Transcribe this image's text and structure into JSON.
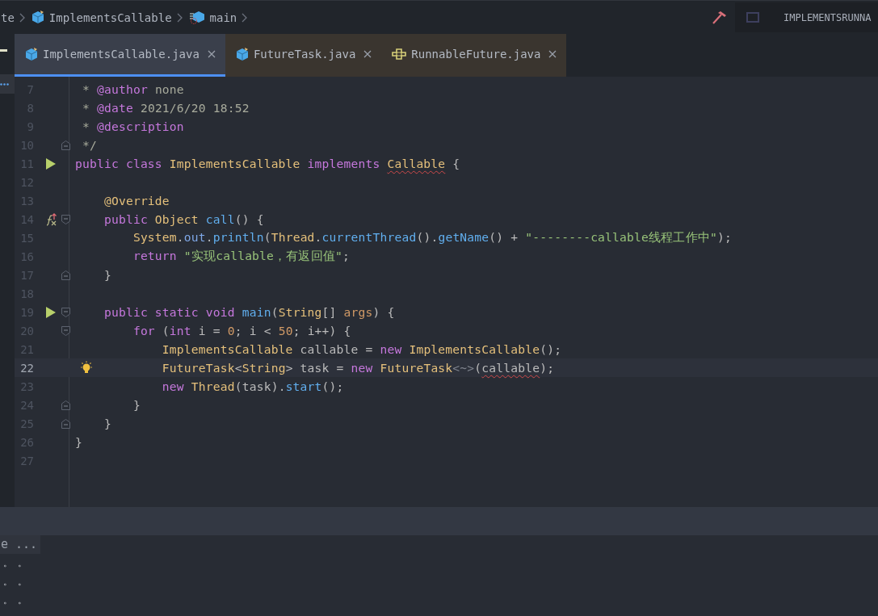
{
  "breadcrumbs": [
    {
      "label": "te",
      "kind": "plain"
    },
    {
      "label": "ImplementsCallable",
      "kind": "class"
    },
    {
      "label": "main",
      "kind": "method"
    }
  ],
  "run_config": {
    "label": "IMPLEMENTSRUNNA"
  },
  "tabs": [
    {
      "label": "ImplementsCallable.java",
      "kind": "class",
      "selected": true
    },
    {
      "label": "FutureTask.java",
      "kind": "class",
      "selected": false
    },
    {
      "label": "RunnableFuture.java",
      "kind": "interface",
      "selected": false
    }
  ],
  "editor": {
    "lines": [
      {
        "number": "7",
        "tokens": [
          {
            "t": " * ",
            "kind": "cmt"
          },
          {
            "t": "@author",
            "kind": "tag"
          },
          {
            "t": " none",
            "kind": "cmt"
          }
        ]
      },
      {
        "number": "8",
        "tokens": [
          {
            "t": " * ",
            "kind": "cmt"
          },
          {
            "t": "@date",
            "kind": "tag"
          },
          {
            "t": " 2021/6/20 18:52",
            "kind": "cmt"
          }
        ]
      },
      {
        "number": "9",
        "tokens": [
          {
            "t": " * ",
            "kind": "cmt"
          },
          {
            "t": "@description",
            "kind": "tag"
          }
        ]
      },
      {
        "number": "10",
        "markers": [
          {
            "kind": "fold_end"
          }
        ],
        "tokens": [
          {
            "t": " */",
            "kind": "cmt"
          }
        ]
      },
      {
        "number": "11",
        "markers": [
          {
            "kind": "run"
          }
        ],
        "tokens": [
          {
            "t": "public class ",
            "kind": "kw"
          },
          {
            "t": "ImplementsCallable ",
            "kind": "cls"
          },
          {
            "t": "implements ",
            "kind": "kw"
          },
          {
            "t": "Callable",
            "kind": "cls",
            "error": true
          },
          {
            "t": " {",
            "kind": "plain"
          }
        ]
      },
      {
        "number": "12"
      },
      {
        "number": "13",
        "tokens": [
          {
            "t": "    @Override",
            "kind": "ann"
          }
        ]
      },
      {
        "number": "14",
        "markers": [
          {
            "kind": "override"
          },
          {
            "kind": "fold_start"
          }
        ],
        "tokens": [
          {
            "t": "    public ",
            "kind": "kw"
          },
          {
            "t": "Object ",
            "kind": "cls"
          },
          {
            "t": "call",
            "kind": "fn"
          },
          {
            "t": "() {",
            "kind": "plain"
          }
        ]
      },
      {
        "number": "15",
        "tokens": [
          {
            "t": "        System",
            "kind": "cls"
          },
          {
            "t": ".",
            "kind": "plain"
          },
          {
            "t": "out",
            "kind": "field"
          },
          {
            "t": ".",
            "kind": "plain"
          },
          {
            "t": "println",
            "kind": "fn"
          },
          {
            "t": "(",
            "kind": "plain"
          },
          {
            "t": "Thread",
            "kind": "cls"
          },
          {
            "t": ".",
            "kind": "plain"
          },
          {
            "t": "currentThread",
            "kind": "fn"
          },
          {
            "t": "().",
            "kind": "plain"
          },
          {
            "t": "getName",
            "kind": "fn"
          },
          {
            "t": "() + ",
            "kind": "plain"
          },
          {
            "t": "\"--------callable线程工作中\"",
            "kind": "str"
          },
          {
            "t": ");",
            "kind": "plain"
          }
        ]
      },
      {
        "number": "16",
        "tokens": [
          {
            "t": "        return ",
            "kind": "kw"
          },
          {
            "t": "\"实现callable，有返回值\"",
            "kind": "str"
          },
          {
            "t": ";",
            "kind": "plain"
          }
        ]
      },
      {
        "number": "17",
        "markers": [
          {
            "kind": "fold_end"
          }
        ],
        "tokens": [
          {
            "t": "    }",
            "kind": "plain"
          }
        ]
      },
      {
        "number": "18"
      },
      {
        "number": "19",
        "markers": [
          {
            "kind": "run"
          },
          {
            "kind": "fold_start"
          }
        ],
        "tokens": [
          {
            "t": "    public static void ",
            "kind": "kw"
          },
          {
            "t": "main",
            "kind": "fn"
          },
          {
            "t": "(",
            "kind": "plain"
          },
          {
            "t": "String",
            "kind": "cls"
          },
          {
            "t": "[] ",
            "kind": "plain"
          },
          {
            "t": "args",
            "kind": "param"
          },
          {
            "t": ") {",
            "kind": "plain"
          }
        ]
      },
      {
        "number": "20",
        "markers": [
          {
            "kind": "fold_start"
          }
        ],
        "tokens": [
          {
            "t": "        for ",
            "kind": "kw"
          },
          {
            "t": "(",
            "kind": "plain"
          },
          {
            "t": "int ",
            "kind": "kw"
          },
          {
            "t": "i = ",
            "kind": "plain"
          },
          {
            "t": "0",
            "kind": "num"
          },
          {
            "t": "; i < ",
            "kind": "plain"
          },
          {
            "t": "50",
            "kind": "num"
          },
          {
            "t": "; i++) {",
            "kind": "plain"
          }
        ]
      },
      {
        "number": "21",
        "tokens": [
          {
            "t": "            ImplementsCallable ",
            "kind": "cls"
          },
          {
            "t": "callable = ",
            "kind": "plain"
          },
          {
            "t": "new ",
            "kind": "kw"
          },
          {
            "t": "ImplementsCallable",
            "kind": "cls"
          },
          {
            "t": "();",
            "kind": "plain"
          }
        ]
      },
      {
        "number": "22",
        "current": true,
        "markers": [
          {
            "kind": "bulb"
          }
        ],
        "tokens": [
          {
            "t": "            FutureTask",
            "kind": "cls"
          },
          {
            "t": "<",
            "kind": "plain"
          },
          {
            "t": "String",
            "kind": "cls"
          },
          {
            "t": "> task = ",
            "kind": "plain"
          },
          {
            "t": "new ",
            "kind": "kw"
          },
          {
            "t": "FutureTask",
            "kind": "cls"
          },
          {
            "t": "<~>",
            "kind": "dim"
          },
          {
            "t": "(",
            "kind": "plain"
          },
          {
            "t": "callable",
            "kind": "plain",
            "error": true
          },
          {
            "t": ");",
            "kind": "plain"
          }
        ]
      },
      {
        "number": "23",
        "tokens": [
          {
            "t": "            new ",
            "kind": "kw"
          },
          {
            "t": "Thread",
            "kind": "cls"
          },
          {
            "t": "(task).",
            "kind": "plain"
          },
          {
            "t": "start",
            "kind": "fn"
          },
          {
            "t": "();",
            "kind": "plain"
          }
        ]
      },
      {
        "number": "24",
        "markers": [
          {
            "kind": "fold_end"
          }
        ],
        "tokens": [
          {
            "t": "        }",
            "kind": "plain"
          }
        ]
      },
      {
        "number": "25",
        "markers": [
          {
            "kind": "fold_end"
          }
        ],
        "tokens": [
          {
            "t": "    }",
            "kind": "plain"
          }
        ]
      },
      {
        "number": "26",
        "tokens": [
          {
            "t": "}",
            "kind": "plain"
          }
        ]
      },
      {
        "number": "27"
      }
    ]
  },
  "bottom_panel": {
    "tab_label": "e ...",
    "rows": [
      "。 。",
      "。 。",
      "。 。"
    ]
  }
}
